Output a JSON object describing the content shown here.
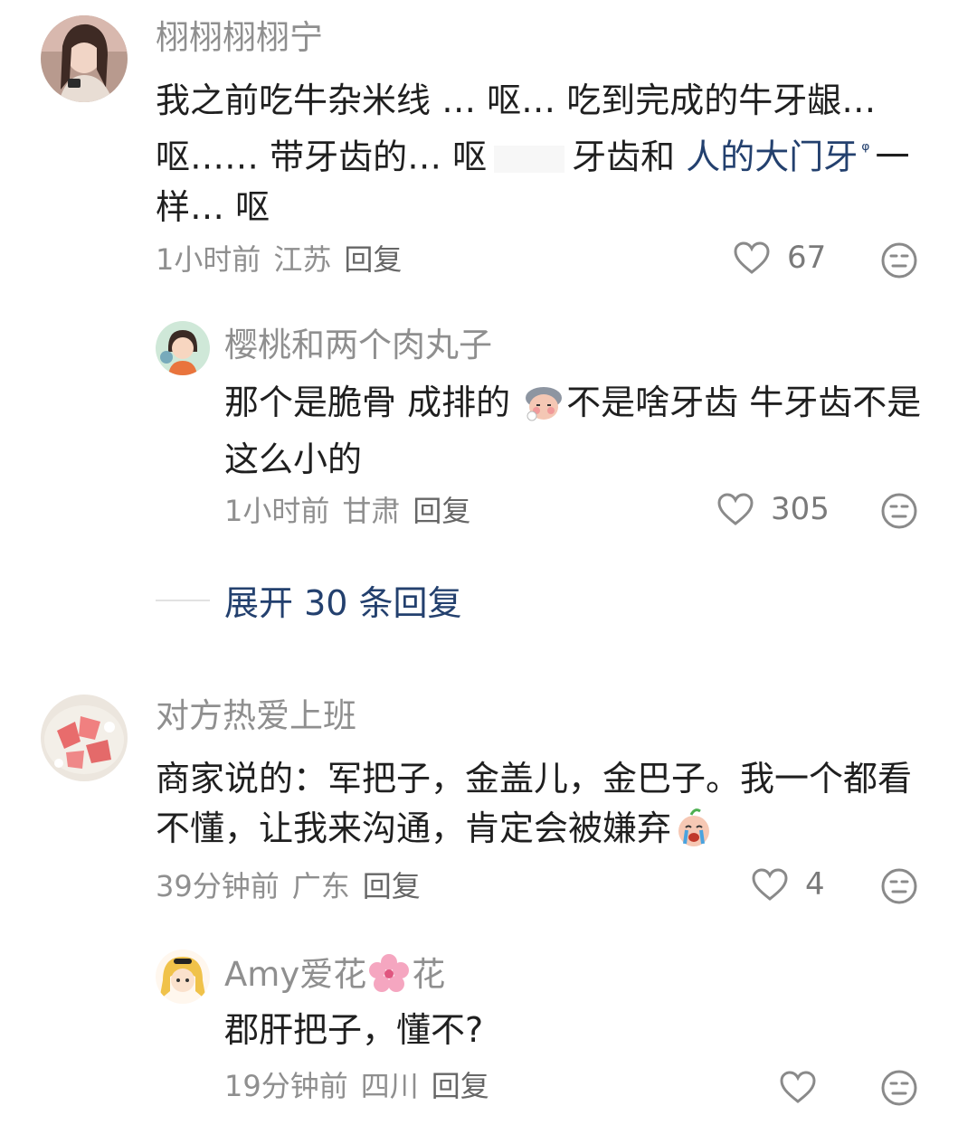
{
  "comments": [
    {
      "username": "栩栩栩栩宁",
      "text_parts": [
        "我之前吃牛杂米线 … 呕… 吃到完成的牛牙龈… 呕…… 带牙齿的… 呕",
        "牙齿和 ",
        "人的大门牙",
        "一样… 呕"
      ],
      "time": "1小时前",
      "location": "江苏",
      "reply_label": "回复",
      "likes": "67",
      "reply": {
        "username": "樱桃和两个肉丸子",
        "text_before_emoji": "那个是脆骨 成排的 ",
        "text_after_emoji": "不是啥牙齿 牛牙齿不是这么小的",
        "time": "1小时前",
        "location": "甘肃",
        "reply_label": "回复",
        "likes": "305"
      },
      "expand_label": "展开 30 条回复"
    },
    {
      "username": "对方热爱上班",
      "text": "商家说的：军把子，金盖儿，金巴子。我一个都看不懂，让我来沟通，肯定会被嫌弃",
      "time": "39分钟前",
      "location": "广东",
      "reply_label": "回复",
      "likes": "4",
      "reply": {
        "username_part1": "Amy爱花",
        "username_part2": "花",
        "text": "郡肝把子，懂不?",
        "time": "19分钟前",
        "location": "四川",
        "reply_label": "回复",
        "likes": ""
      }
    }
  ],
  "colors": {
    "link": "#23406e",
    "meta": "#8f8f8f",
    "text": "#1f1f1f"
  },
  "icons": [
    "heart-outline-icon",
    "dislike-face-icon",
    "search-small-icon",
    "sheep-emoji-icon",
    "crying-emoji-icon",
    "cherry-blossom-icon"
  ]
}
